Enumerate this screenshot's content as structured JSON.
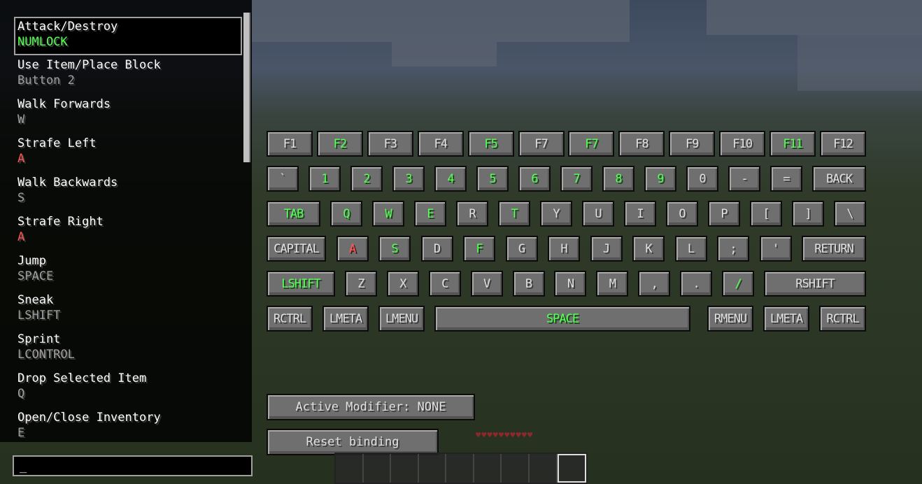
{
  "bindings": [
    {
      "action": "Attack/Destroy",
      "key": "NUMLOCK",
      "state": "bound",
      "selected": true
    },
    {
      "action": "Use Item/Place Block",
      "key": "Button 2",
      "state": "normal"
    },
    {
      "action": "Walk Forwards",
      "key": "W",
      "state": "normal"
    },
    {
      "action": "Strafe Left",
      "key": "A",
      "state": "conflict"
    },
    {
      "action": "Walk Backwards",
      "key": "S",
      "state": "normal"
    },
    {
      "action": "Strafe Right",
      "key": "A",
      "state": "conflict"
    },
    {
      "action": "Jump",
      "key": "SPACE",
      "state": "normal"
    },
    {
      "action": "Sneak",
      "key": "LSHIFT",
      "state": "normal"
    },
    {
      "action": "Sprint",
      "key": "LCONTROL",
      "state": "normal"
    },
    {
      "action": "Drop Selected Item",
      "key": "Q",
      "state": "normal"
    },
    {
      "action": "Open/Close Inventory",
      "key": "E",
      "state": "normal"
    }
  ],
  "search": {
    "value": "_"
  },
  "keyboard": {
    "rows": [
      [
        [
          "F1",
          "n"
        ],
        [
          "F2",
          "b"
        ],
        [
          "F3",
          "n"
        ],
        [
          "F4",
          "n"
        ],
        [
          "F5",
          "b"
        ],
        [
          "F7",
          "n"
        ],
        [
          "F7",
          "b"
        ],
        [
          "F8",
          "n"
        ],
        [
          "F9",
          "n"
        ],
        [
          "F10",
          "n"
        ],
        [
          "F11",
          "b"
        ],
        [
          "F12",
          "n"
        ]
      ],
      [
        [
          "`",
          "n"
        ],
        [
          "1",
          "b"
        ],
        [
          "2",
          "b"
        ],
        [
          "3",
          "b"
        ],
        [
          "4",
          "b"
        ],
        [
          "5",
          "b"
        ],
        [
          "6",
          "b"
        ],
        [
          "7",
          "b"
        ],
        [
          "8",
          "b"
        ],
        [
          "9",
          "b"
        ],
        [
          "0",
          "n"
        ],
        [
          "-",
          "n"
        ],
        [
          "=",
          "n"
        ],
        [
          "BACK",
          "n"
        ]
      ],
      [
        [
          "TAB",
          "b"
        ],
        [
          "Q",
          "b"
        ],
        [
          "W",
          "b"
        ],
        [
          "E",
          "b"
        ],
        [
          "R",
          "n"
        ],
        [
          "T",
          "b"
        ],
        [
          "Y",
          "n"
        ],
        [
          "U",
          "n"
        ],
        [
          "I",
          "n"
        ],
        [
          "O",
          "n"
        ],
        [
          "P",
          "n"
        ],
        [
          "[",
          "n"
        ],
        [
          "]",
          "n"
        ],
        [
          "\\",
          "n"
        ]
      ],
      [
        [
          "CAPITAL",
          "n"
        ],
        [
          "A",
          "c"
        ],
        [
          "S",
          "b"
        ],
        [
          "D",
          "n"
        ],
        [
          "F",
          "b"
        ],
        [
          "G",
          "n"
        ],
        [
          "H",
          "n"
        ],
        [
          "J",
          "n"
        ],
        [
          "K",
          "n"
        ],
        [
          "L",
          "n"
        ],
        [
          ";",
          "n"
        ],
        [
          "'",
          "n"
        ],
        [
          "RETURN",
          "n"
        ]
      ],
      [
        [
          "LSHIFT",
          "b"
        ],
        [
          "Z",
          "n"
        ],
        [
          "X",
          "n"
        ],
        [
          "C",
          "n"
        ],
        [
          "V",
          "n"
        ],
        [
          "B",
          "n"
        ],
        [
          "N",
          "n"
        ],
        [
          "M",
          "n"
        ],
        [
          ",",
          "n"
        ],
        [
          ".",
          "n"
        ],
        [
          "/",
          "b"
        ],
        [
          "RSHIFT",
          "n"
        ]
      ],
      [
        [
          "RCTRL",
          "n"
        ],
        [
          "LMETA",
          "n"
        ],
        [
          "LMENU",
          "n"
        ],
        [
          "SPACE",
          "b"
        ],
        [
          "RMENU",
          "n"
        ],
        [
          "LMETA",
          "n"
        ],
        [
          "RCTRL",
          "n"
        ]
      ]
    ],
    "colors": {
      "bound": "#55ff55",
      "conflict": "#ff5555",
      "normal": "#e0e0e0"
    }
  },
  "buttons": {
    "modifier": "Active Modifier: NONE",
    "reset": "Reset binding"
  }
}
